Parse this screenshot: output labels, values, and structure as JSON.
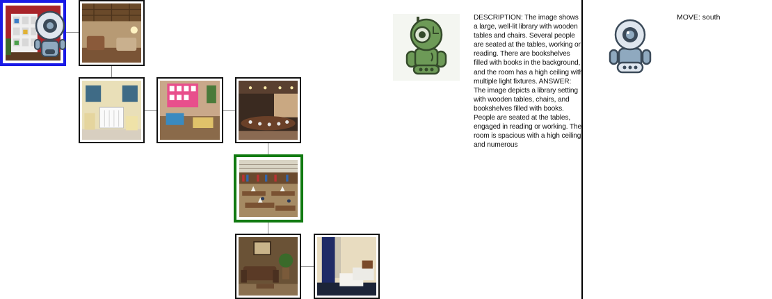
{
  "map": {
    "current_node": "red-shelf-room",
    "target_node": "library",
    "nodes": [
      {
        "id": "red-shelf-room",
        "scene": "living room with red walls and white bookshelves",
        "state": "current"
      },
      {
        "id": "wood-ceiling-lounge",
        "scene": "lounge with wooden ceiling and armchairs",
        "state": "normal"
      },
      {
        "id": "nursery",
        "scene": "nursery with crib and blue curtains",
        "state": "normal"
      },
      {
        "id": "classroom",
        "scene": "classroom with pink bulletin board",
        "state": "normal"
      },
      {
        "id": "conference-room",
        "scene": "conference room with long table",
        "state": "normal"
      },
      {
        "id": "library",
        "scene": "library with wooden tables and chairs",
        "state": "target"
      },
      {
        "id": "sitting-room",
        "scene": "sitting room with brown sofa and plant",
        "state": "normal"
      },
      {
        "id": "bedroom",
        "scene": "bedroom with twin beds and blue curtains",
        "state": "normal"
      }
    ]
  },
  "agent": {
    "description": "DESCRIPTION: The image shows a large, well-lit library with wooden tables and chairs. Several people are seated at the tables, working or reading. There are bookshelves filled with books in the background, and the room has a high ceiling with multiple light fixtures.  ANSWER: The image depicts a library setting with wooden tables, chairs, and bookshelves filled with books. People are seated at the tables, engaged in reading or working. The room is spacious with a high ceiling and numerous",
    "move_text": "MOVE: south"
  },
  "colors": {
    "current_border": "#1a1ae6",
    "target_border": "#117a11",
    "green_robot": "#6d9a57",
    "blue_robot": "#8fa9bf"
  },
  "icons": [
    "robot-icon-blue",
    "robot-icon-green"
  ]
}
